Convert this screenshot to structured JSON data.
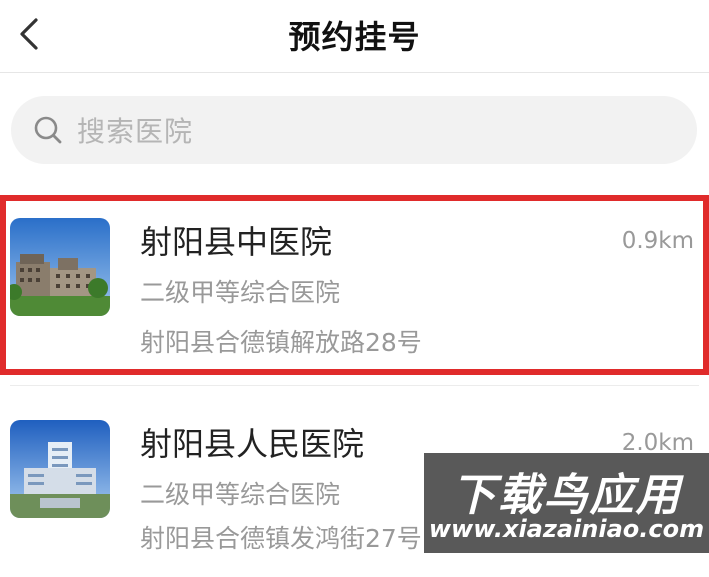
{
  "header": {
    "title": "预约挂号",
    "back_icon": "chevron-left-icon"
  },
  "search": {
    "placeholder": "搜索医院",
    "icon": "search-icon"
  },
  "hospitals": [
    {
      "name": "射阳县中医院",
      "level": "二级甲等综合医院",
      "address": "射阳县合德镇解放路28号",
      "distance": "0.9km",
      "selected": true
    },
    {
      "name": "射阳县人民医院",
      "level": "二级甲等综合医院",
      "address": "射阳县合德镇发鸿街27号",
      "distance": "2.0km",
      "selected": false
    }
  ],
  "watermark": {
    "main": "下载鸟应用",
    "sub": "www.xiazainiao.com"
  },
  "colors": {
    "selection_border": "#e02b2b",
    "search_bg": "#f2f2f2",
    "secondary_text": "#999999"
  }
}
